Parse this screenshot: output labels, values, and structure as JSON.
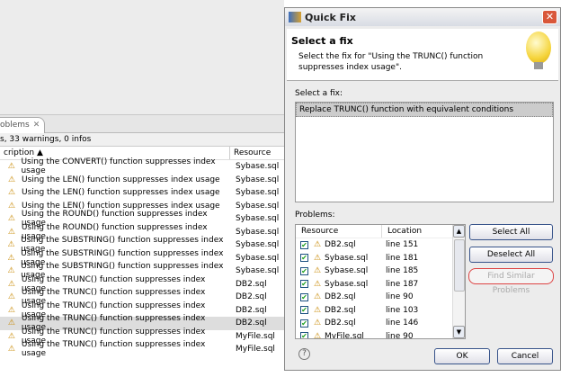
{
  "problems_view": {
    "tab_label": "oblems",
    "tab_close": "✕",
    "summary": "s, 33 warnings, 0 infos",
    "col_description": "cription ▲",
    "col_resource": "Resource",
    "rows": [
      {
        "d": "Using the CONVERT() function suppresses index usage",
        "r": "Sybase.sql"
      },
      {
        "d": "Using the LEN() function suppresses index usage",
        "r": "Sybase.sql"
      },
      {
        "d": "Using the LEN() function suppresses index usage",
        "r": "Sybase.sql"
      },
      {
        "d": "Using the LEN() function suppresses index usage",
        "r": "Sybase.sql"
      },
      {
        "d": "Using the ROUND() function suppresses index usage",
        "r": "Sybase.sql"
      },
      {
        "d": "Using the ROUND() function suppresses index usage",
        "r": "Sybase.sql"
      },
      {
        "d": "Using the SUBSTRING() function suppresses index usage",
        "r": "Sybase.sql"
      },
      {
        "d": "Using the SUBSTRING() function suppresses index usage",
        "r": "Sybase.sql"
      },
      {
        "d": "Using the SUBSTRING() function suppresses index usage",
        "r": "Sybase.sql"
      },
      {
        "d": "Using the TRUNC() function suppresses index usage",
        "r": "DB2.sql"
      },
      {
        "d": "Using the TRUNC() function suppresses index usage",
        "r": "DB2.sql"
      },
      {
        "d": "Using the TRUNC() function suppresses index usage",
        "r": "DB2.sql"
      },
      {
        "d": "Using the TRUNC() function suppresses index usage",
        "r": "DB2.sql",
        "selected": true
      },
      {
        "d": "Using the TRUNC() function suppresses index usage",
        "r": "MyFile.sql"
      },
      {
        "d": "Using the TRUNC() function suppresses index usage",
        "r": "MyFile.sql"
      }
    ]
  },
  "dialog": {
    "title": "Quick Fix",
    "close": "✕",
    "heading": "Select a fix",
    "description": "Select the fix for \"Using the TRUNC() function suppresses index usage\".",
    "fix_label": "Select a fix:",
    "fixes": [
      "Replace TRUNC() function with equivalent conditions"
    ],
    "problems_label": "Problems:",
    "col_resource": "Resource",
    "col_location": "Location",
    "problems": [
      {
        "r": "DB2.sql",
        "l": "line 151"
      },
      {
        "r": "Sybase.sql",
        "l": "line 181"
      },
      {
        "r": "Sybase.sql",
        "l": "line 185"
      },
      {
        "r": "Sybase.sql",
        "l": "line 187"
      },
      {
        "r": "DB2.sql",
        "l": "line 90"
      },
      {
        "r": "DB2.sql",
        "l": "line 103"
      },
      {
        "r": "DB2.sql",
        "l": "line 146"
      },
      {
        "r": "MyFile.sql",
        "l": "line 90"
      }
    ],
    "select_all": "Select All",
    "deselect_all": "Deselect All",
    "find_similar": "Find Similar Problems",
    "ok": "OK",
    "cancel": "Cancel",
    "help": "?"
  }
}
